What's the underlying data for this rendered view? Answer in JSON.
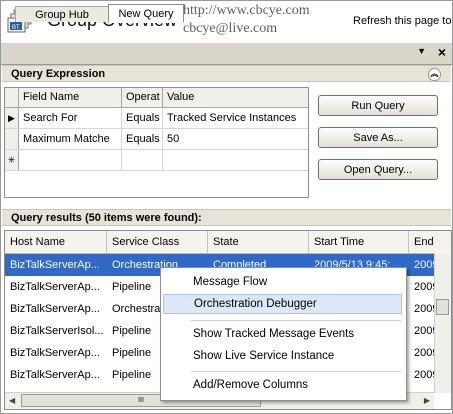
{
  "header": {
    "title": "Group Overview",
    "watermark_line1": "http://www.cbcye.com",
    "watermark_line2": "cbcye@live.com",
    "refresh_text": "Refresh this page to"
  },
  "tabs": [
    {
      "label": "Group Hub",
      "active": false
    },
    {
      "label": "New Query",
      "active": true
    }
  ],
  "tab_controls": {
    "pin": "▼",
    "close": "×"
  },
  "query_expression": {
    "title": "Query Expression",
    "columns": [
      "Field Name",
      "Operat",
      "Value"
    ],
    "rows": [
      {
        "indicator": "▶",
        "field": "Search For",
        "operator": "Equals",
        "value": "Tracked Service Instances"
      },
      {
        "indicator": "",
        "field": "Maximum Matche",
        "operator": "Equals",
        "value": "50"
      },
      {
        "indicator": "✳",
        "field": "",
        "operator": "",
        "value": ""
      }
    ]
  },
  "buttons": {
    "run": "Run Query",
    "save": "Save As...",
    "open": "Open Query..."
  },
  "results": {
    "title": "Query results (50 items were found):",
    "columns": [
      "Host Name",
      "Service Class",
      "State",
      "Start Time",
      "End"
    ],
    "rows": [
      {
        "host": "BizTalkServerAp...",
        "class": "Orchestration",
        "state": "Completed",
        "start": "2009/5/13 9:45:",
        "end": "2009",
        "selected": true
      },
      {
        "host": "BizTalkServerAp...",
        "class": "Pipeline",
        "state": "",
        "start": "",
        "end": "2009",
        "selected": false
      },
      {
        "host": "BizTalkServerAp...",
        "class": "Orchestra",
        "state": "",
        "start": "",
        "end": "2009",
        "selected": false
      },
      {
        "host": "BizTalkServerIsol...",
        "class": "Pipeline",
        "state": "",
        "start": "",
        "end": "2009",
        "selected": false
      },
      {
        "host": "BizTalkServerAp...",
        "class": "Pipeline",
        "state": "",
        "start": "",
        "end": "2009",
        "selected": false
      },
      {
        "host": "BizTalkServerAp...",
        "class": "Pipeline",
        "state": "",
        "start": "",
        "end": "2009",
        "selected": false
      }
    ]
  },
  "context_menu": {
    "items": [
      {
        "label": "Message Flow",
        "highlighted": false
      },
      {
        "label": "Orchestration Debugger",
        "highlighted": true
      },
      {
        "label": "Show Tracked Message Events",
        "highlighted": false
      },
      {
        "label": "Show Live Service Instance",
        "highlighted": false
      },
      {
        "label": "Add/Remove Columns",
        "highlighted": false
      }
    ]
  },
  "scrollbar_grip": "III",
  "colors": {
    "selection": "#3169c6",
    "menu_highlight": "#dce8f8",
    "section_bar": "#e7e3d6"
  }
}
